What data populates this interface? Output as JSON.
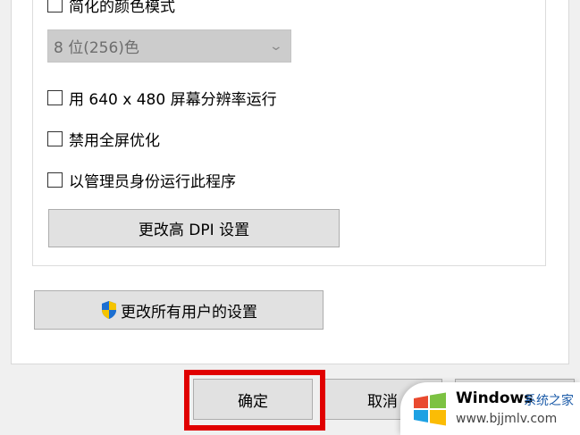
{
  "compat": {
    "reduced_color_label": "简化的颜色模式",
    "color_select_value": "8 位(256)色",
    "run_640_label": "用 640 x 480 屏幕分辨率运行",
    "disable_fullscreen_label": "禁用全屏优化",
    "run_as_admin_label": "以管理员身份运行此程序",
    "change_dpi_label": "更改高 DPI 设置"
  },
  "change_all_users_label": "更改所有用户的设置",
  "footer": {
    "ok_label": "确定",
    "cancel_label": "取消"
  },
  "watermark": {
    "title": "Windows",
    "chinese": "系统之家",
    "url": "www.bjjmlv.com"
  },
  "colors": {
    "highlight": "#e00000",
    "shield_blue": "#1c6fd1",
    "shield_yellow": "#f5c400"
  }
}
